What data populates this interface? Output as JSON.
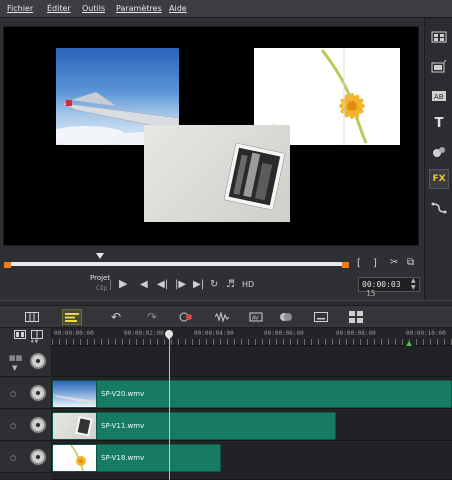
{
  "menu": [
    "Fichier",
    "Éditer",
    "Outils",
    "Paramètres",
    "Aide"
  ],
  "preview": {
    "mode_project": "Projet",
    "mode_clip": "Clip",
    "quality": "HD",
    "timecode": "00:00:03",
    "timecode_frames": "15"
  },
  "right_toolbar": [
    "media-icon",
    "instant-project-icon",
    "title-preset-icon",
    "text-icon",
    "filter-icon",
    "fx-icon",
    "path-icon"
  ],
  "right_toolbar_fx_label": "FX",
  "right_toolbar_text_label": "T",
  "timeline": {
    "ruler_ticks": [
      "00:00:00:00",
      "00:00:02:00",
      "00:00:04:00",
      "00:00:06:00",
      "00:00:08:00",
      "00:00:10:00"
    ],
    "tracks": [
      {
        "name": "SP-V20.wmv"
      },
      {
        "name": "SP-V11.wmv"
      },
      {
        "name": "SP-V18.wmv"
      }
    ]
  },
  "colors": {
    "accent_orange": "#f07a1e",
    "clip_green": "#177a63",
    "active_tool": "#4a4d35",
    "fx_yellow": "#f1c22a"
  }
}
